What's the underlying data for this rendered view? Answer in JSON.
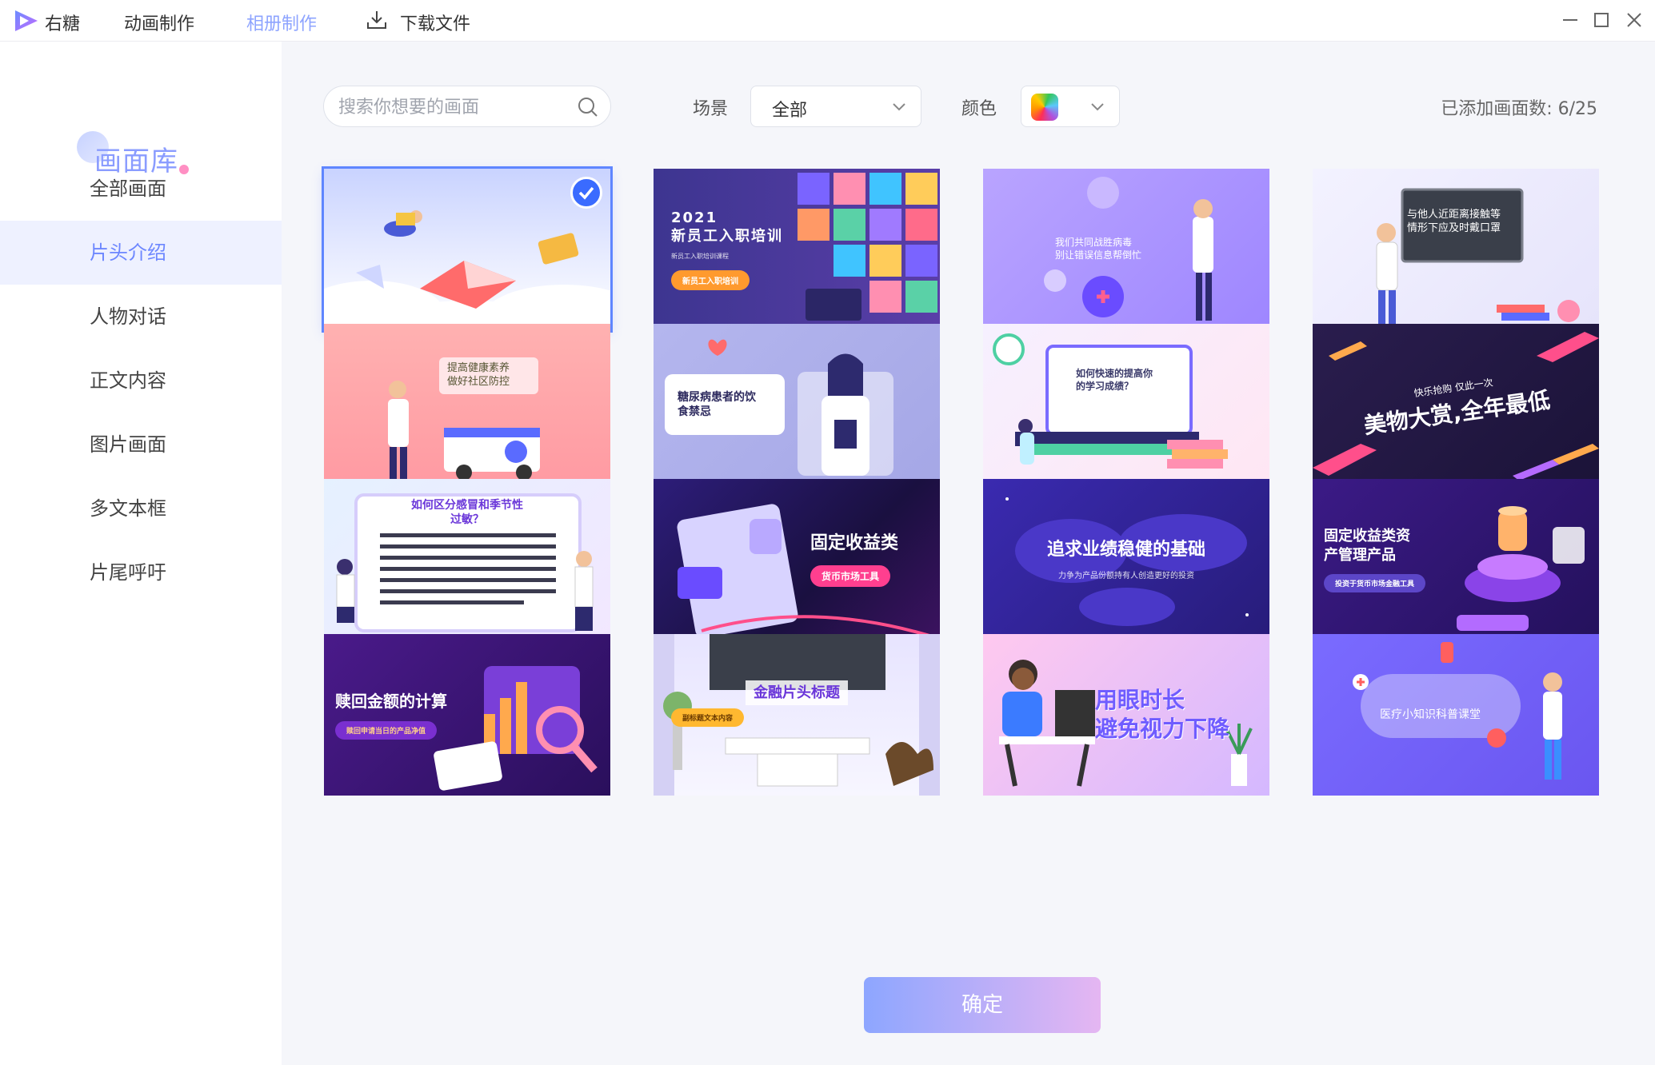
{
  "titlebar": {
    "app_name": "右糖",
    "menu": [
      "动画制作",
      "相册制作",
      "下载文件"
    ]
  },
  "sidebar": {
    "title": "画面库",
    "items": [
      "全部画面",
      "片头介绍",
      "人物对话",
      "正文内容",
      "图片画面",
      "多文本框",
      "片尾呼吁"
    ]
  },
  "filters": {
    "search_placeholder": "搜索你想要的画面",
    "scene_label": "场景",
    "scene_value": "全部",
    "color_label": "颜色",
    "added_count": "已添加画面数: 6/25"
  },
  "cards": [
    {
      "title": "",
      "sub": "",
      "pill": ""
    },
    {
      "title": "2021\n新员工入职培训",
      "sub": "新员工入职培训课程",
      "pill": "新员工入职培训"
    },
    {
      "title": "我们共同战胜病毒\n别让错误信息帮倒忙",
      "sub": "",
      "pill": ""
    },
    {
      "title": "与他人近距离接触等\n情形下应及时戴口罩",
      "sub": "",
      "pill": ""
    },
    {
      "title": "提高健康素养\n做好社区防控",
      "sub": "",
      "pill": ""
    },
    {
      "title": "糖尿病患者的饮\n食禁忌",
      "sub": "",
      "pill": ""
    },
    {
      "title": "如何快速的提高你\n的学习成绩？",
      "sub": "",
      "pill": ""
    },
    {
      "title": "美物大赏,全年最低",
      "sub": "快乐抢购 仅此一次",
      "pill": ""
    },
    {
      "title": "如何区分感冒和季节性\n过敏？",
      "sub": "",
      "pill": ""
    },
    {
      "title": "固定收益类",
      "sub": "",
      "pill": "货币市场工具"
    },
    {
      "title": "追求业绩稳健的基础",
      "sub": "力争为产品份额持有人创造更好的投资",
      "pill": ""
    },
    {
      "title": "固定收益类资\n产管理产品",
      "sub": "",
      "pill": "投资于货币市场金融工具"
    },
    {
      "title": "赎回金额的计算",
      "sub": "",
      "pill": "赎回申请当日的产品净值"
    },
    {
      "title": "金融片头标题",
      "sub": "",
      "pill": "副标题文本内容"
    },
    {
      "title": "用眼时长\n避免视力下降",
      "sub": "",
      "pill": ""
    },
    {
      "title": "医疗小知识科普课堂",
      "sub": "",
      "pill": ""
    }
  ],
  "confirm_label": "确定",
  "colors": {
    "accent": "#6d87ff",
    "sidebar_active_bg": "#eef1ff",
    "main_bg": "#f5f6fa"
  }
}
